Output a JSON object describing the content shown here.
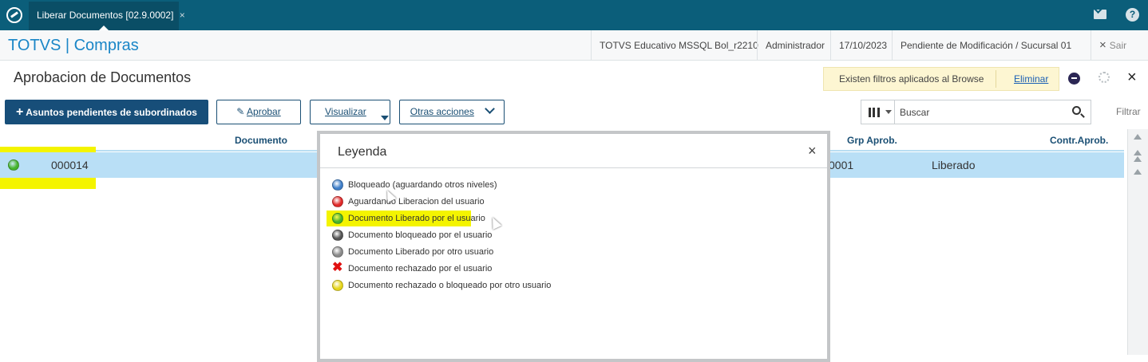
{
  "topbar": {
    "tab_label": "Liberar Documentos [02.9.0002]",
    "tab_close": "×"
  },
  "header": {
    "app_title": "TOTVS | Compras",
    "environment": "TOTVS Educativo MSSQL Bol_r2210",
    "user": "Administrador",
    "date": "17/10/2023",
    "branch": "Pendiente de Modificación / Sucursal 01",
    "exit_label": "Sair",
    "exit_x": "×"
  },
  "page": {
    "title": "Aprobacion de Documentos",
    "filter_notice": "Existen filtros aplicados al Browse",
    "filter_remove": "Eliminar",
    "close": "×"
  },
  "toolbar": {
    "subordinates_label": "Asuntos pendientes de subordinados",
    "approve_label": "Aprobar",
    "view_label": "Visualizar",
    "other_actions_label": "Otras acciones",
    "search_placeholder": "Buscar",
    "filter_label": "Filtrar"
  },
  "grid": {
    "columns": [
      "Documento",
      "Grp Aprob.",
      "Contr.Aprob."
    ],
    "rows": [
      {
        "documento": "000014",
        "grp_aprob": "0001",
        "status_text": "Liberado",
        "status_color": "#46b42d"
      }
    ]
  },
  "legend": {
    "title": "Leyenda",
    "close": "×",
    "items": [
      {
        "label": "Bloqueado (aguardando otros niveles)",
        "icon": "blue-circle",
        "color": "#3f7fc9"
      },
      {
        "label": "Aguardando Liberacion del usuario",
        "icon": "red-circle",
        "color": "#e02a2a"
      },
      {
        "label": "Documento Liberado por el usuario",
        "icon": "green-circle",
        "color": "#46b42d"
      },
      {
        "label": "Documento bloqueado por el usuario",
        "icon": "dark-gray-circle",
        "color": "#555555"
      },
      {
        "label": "Documento Liberado por otro usuario",
        "icon": "gray-circle",
        "color": "#8a8a8a"
      },
      {
        "label": "Documento rechazado por el usuario",
        "icon": "red-x",
        "color": "#e01010"
      },
      {
        "label": "Documento rechazado o bloqueado por otro usuario",
        "icon": "yellow-circle",
        "color": "#e6d51a"
      }
    ]
  }
}
